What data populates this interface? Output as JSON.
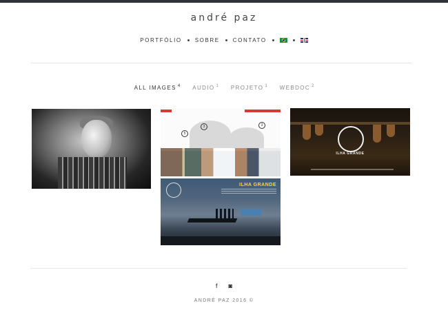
{
  "site": {
    "title": "andré paz"
  },
  "nav": {
    "items": [
      {
        "label": "PORTFÓLIO"
      },
      {
        "label": "SOBRE"
      },
      {
        "label": "CONTATO"
      }
    ],
    "languages": [
      {
        "name": "flag-br-icon"
      },
      {
        "name": "flag-uk-icon"
      }
    ]
  },
  "filters": [
    {
      "label": "ALL IMAGES",
      "count": "4"
    },
    {
      "label": "AUDIO",
      "count": "1"
    },
    {
      "label": "PROJETO",
      "count": "1"
    },
    {
      "label": "WEBDOC",
      "count": "2"
    }
  ],
  "portfolio": {
    "ilha_title": "ILHA GRANDE",
    "badge_title": "ILHA GRANDE"
  },
  "footer": {
    "social": [
      {
        "icon": "facebook-icon",
        "glyph": "f"
      },
      {
        "icon": "instagram-icon",
        "glyph": "◙"
      }
    ],
    "copyright": "ANDRÉ PAZ 2016 ©"
  },
  "colors": {
    "topbar": "#2f3237",
    "accent_red": "#d43a2e",
    "ilha_yellow": "#ffd64a"
  }
}
